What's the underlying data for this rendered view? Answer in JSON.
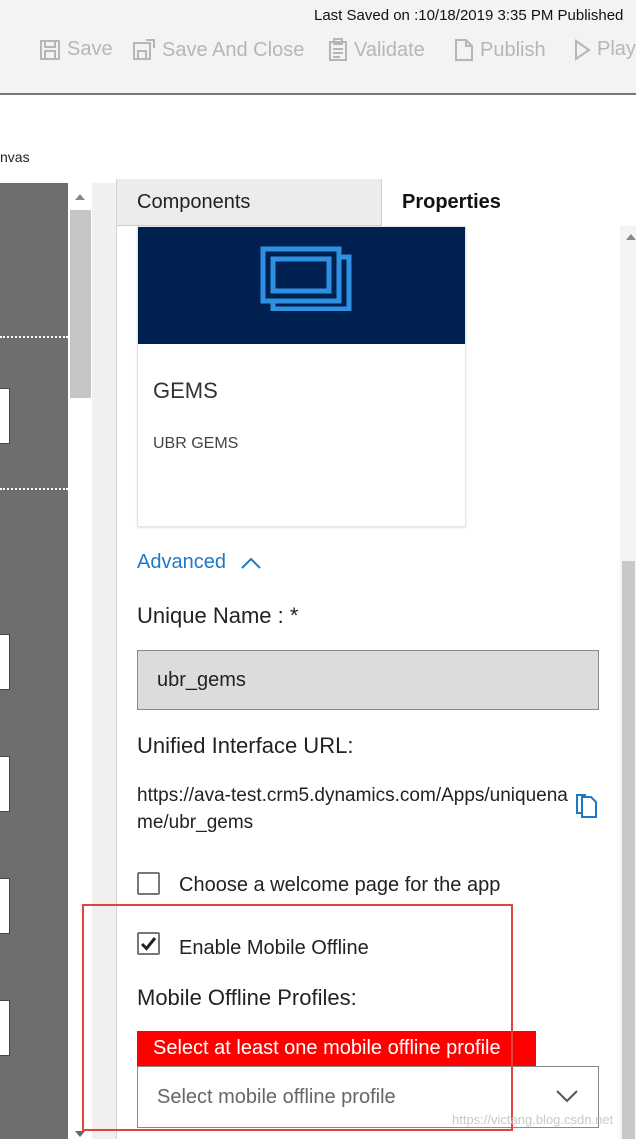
{
  "header": {
    "last_saved": "Last Saved on :10/18/2019 3:35 PM Published",
    "commands": {
      "save": "Save",
      "save_and_close": "Save And Close",
      "validate": "Validate",
      "publish": "Publish",
      "play": "Play"
    }
  },
  "breadcrumb": {
    "text": "nvas"
  },
  "panel": {
    "tabs": {
      "components": "Components",
      "properties": "Properties"
    },
    "app_tile": {
      "title": "GEMS",
      "subtitle": "UBR GEMS"
    },
    "advanced_label": "Advanced",
    "unique_name": {
      "label": "Unique Name : *",
      "value": "ubr_gems"
    },
    "unified_url": {
      "label": "Unified Interface URL:",
      "value": "https://ava-test.crm5.dynamics.com/Apps/uniquename/ubr_gems"
    },
    "welcome_page": {
      "label": "Choose a welcome page for the app",
      "checked": false
    },
    "mobile_offline": {
      "label": "Enable Mobile Offline",
      "checked": true
    },
    "profiles": {
      "label": "Mobile Offline Profiles:",
      "error": "Select at least one mobile offline profile",
      "placeholder": "Select mobile offline profile"
    }
  },
  "watermark": "https://victang.blog.csdn.net",
  "colors": {
    "accent_blue": "#1e78c8",
    "tile_banner": "#002050",
    "error_red": "#fd0000",
    "highlight_border": "#e1443f"
  }
}
